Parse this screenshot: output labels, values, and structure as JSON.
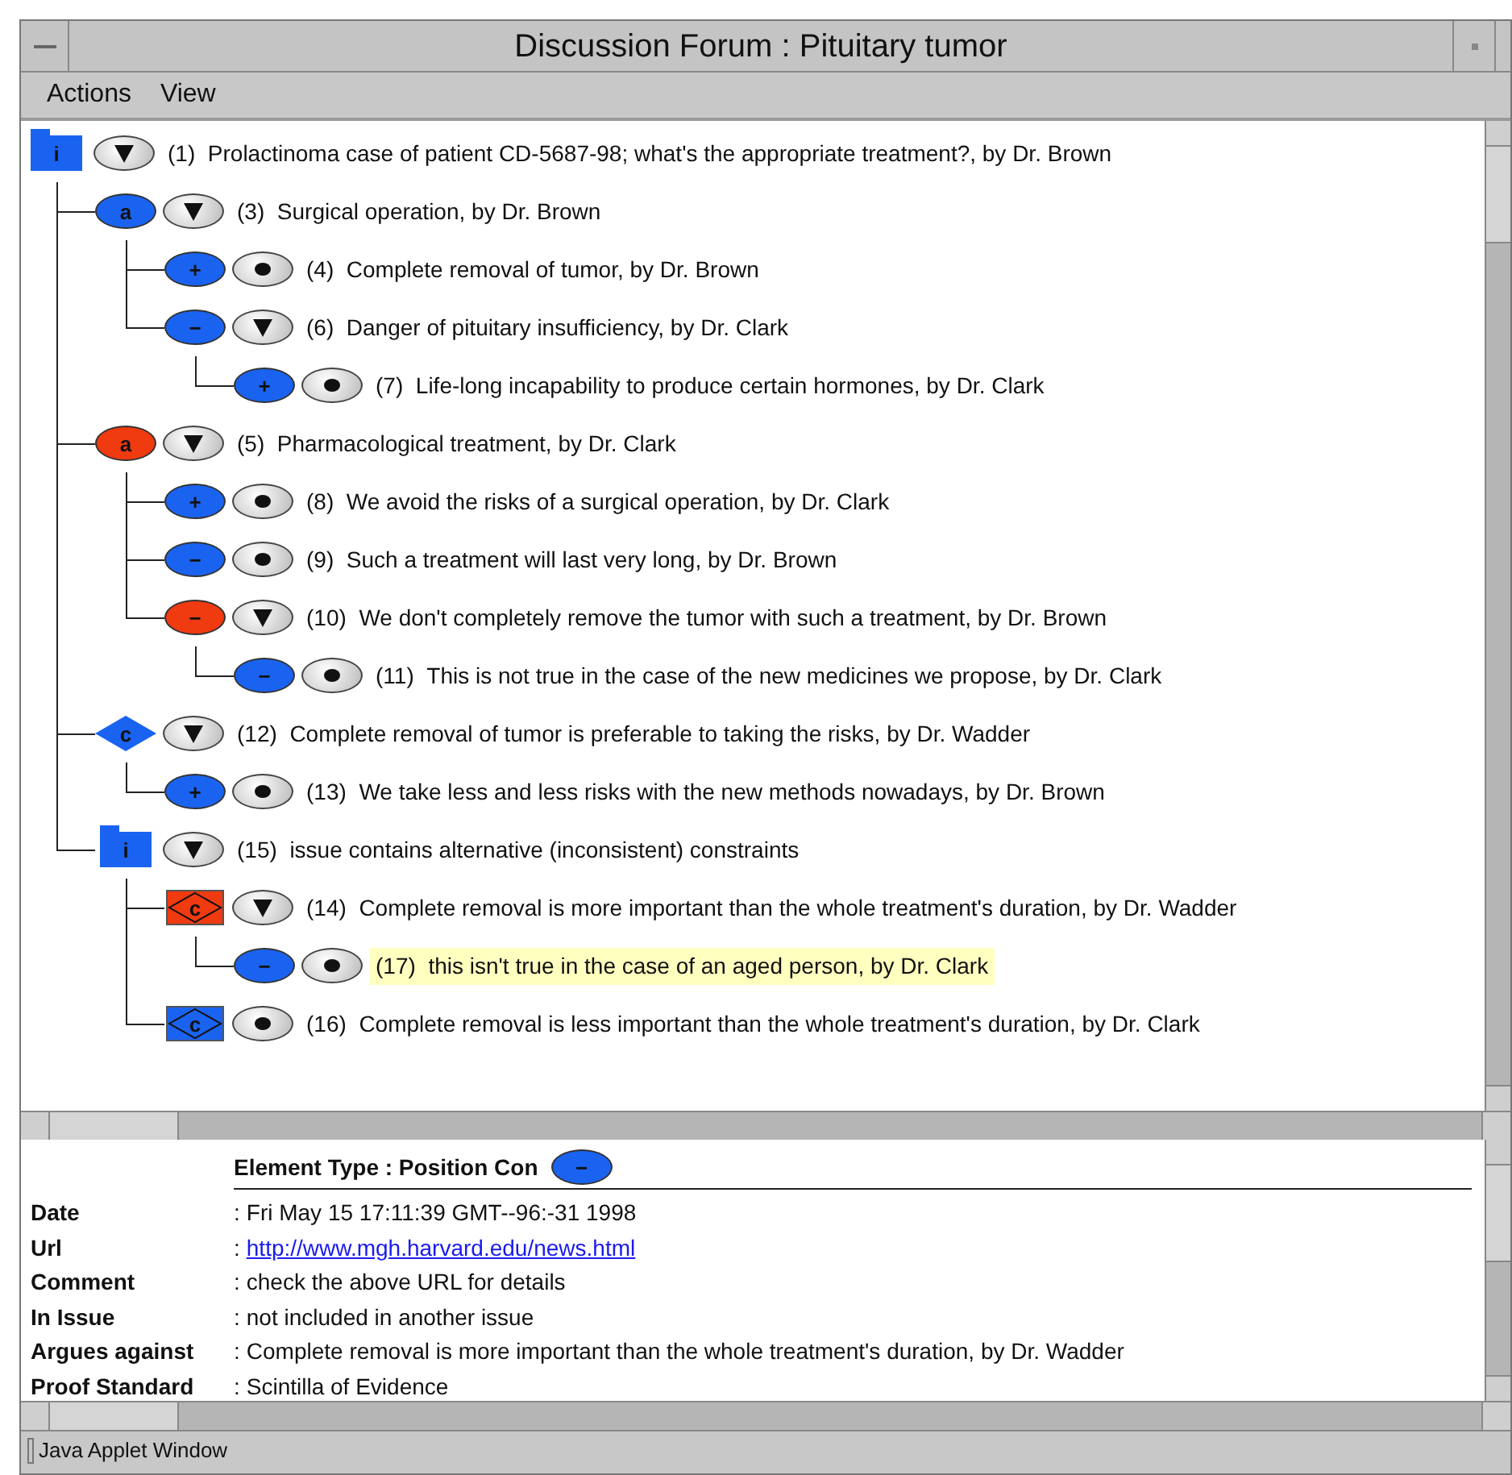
{
  "window": {
    "title": "Discussion Forum : Pituitary tumor"
  },
  "menu": [
    {
      "label": "Actions"
    },
    {
      "label": "View"
    }
  ],
  "tree": [
    {
      "kind": "folder",
      "symbol": "i",
      "color": "#1a63f0",
      "expandable": true,
      "number": "(1)",
      "text": "Prolactinoma case of patient CD-5687-98; what's the appropriate treatment?, by Dr. Brown",
      "highlighted": false,
      "children": [
        {
          "kind": "ellipse",
          "symbol": "a",
          "color": "#1a63f0",
          "expandable": true,
          "number": "(3)",
          "text": "Surgical operation, by Dr. Brown",
          "highlighted": false,
          "children": [
            {
              "kind": "ellipse",
              "symbol": "+",
              "color": "#1a63f0",
              "expandable": false,
              "number": "(4)",
              "text": "Complete removal of tumor, by Dr. Brown",
              "highlighted": false
            },
            {
              "kind": "ellipse",
              "symbol": "−",
              "color": "#1a63f0",
              "expandable": true,
              "number": "(6)",
              "text": "Danger of pituitary insufficiency, by Dr. Clark",
              "highlighted": false,
              "children": [
                {
                  "kind": "ellipse",
                  "symbol": "+",
                  "color": "#1a63f0",
                  "expandable": false,
                  "number": "(7)",
                  "text": "Life-long incapability to produce certain hormones, by Dr. Clark",
                  "highlighted": false
                }
              ]
            }
          ]
        },
        {
          "kind": "ellipse",
          "symbol": "a",
          "color": "#f03a10",
          "expandable": true,
          "number": "(5)",
          "text": "Pharmacological treatment, by Dr. Clark",
          "highlighted": false,
          "children": [
            {
              "kind": "ellipse",
              "symbol": "+",
              "color": "#1a63f0",
              "expandable": false,
              "number": "(8)",
              "text": "We avoid the risks of a surgical operation, by Dr. Clark",
              "highlighted": false
            },
            {
              "kind": "ellipse",
              "symbol": "−",
              "color": "#1a63f0",
              "expandable": false,
              "number": "(9)",
              "text": "Such a treatment will last very long, by Dr. Brown",
              "highlighted": false
            },
            {
              "kind": "ellipse",
              "symbol": "−",
              "color": "#f03a10",
              "expandable": true,
              "number": "(10)",
              "text": "We don't completely remove the tumor with such a treatment, by Dr. Brown",
              "highlighted": false,
              "children": [
                {
                  "kind": "ellipse",
                  "symbol": "−",
                  "color": "#1a63f0",
                  "expandable": false,
                  "number": "(11)",
                  "text": "This is not true in the case of the new medicines we propose, by Dr. Clark",
                  "highlighted": false
                }
              ]
            }
          ]
        },
        {
          "kind": "diamond",
          "symbol": "c",
          "color": "#1a63f0",
          "expandable": true,
          "number": "(12)",
          "text": "Complete removal of tumor is preferable to taking the risks, by Dr. Wadder",
          "highlighted": false,
          "children": [
            {
              "kind": "ellipse",
              "symbol": "+",
              "color": "#1a63f0",
              "expandable": false,
              "number": "(13)",
              "text": "We take less and less risks with the new methods nowadays, by Dr. Brown",
              "highlighted": false
            }
          ]
        },
        {
          "kind": "folder",
          "symbol": "i",
          "color": "#1a63f0",
          "expandable": true,
          "number": "(15)",
          "text": "issue contains alternative (inconsistent) constraints",
          "highlighted": false,
          "children": [
            {
              "kind": "boxed_diamond",
              "symbol": "c",
              "color": "#f03a10",
              "expandable": true,
              "number": "(14)",
              "text": "Complete removal is more important than the whole treatment's duration, by Dr. Wadder",
              "highlighted": false,
              "children": [
                {
                  "kind": "ellipse",
                  "symbol": "−",
                  "color": "#1a63f0",
                  "expandable": false,
                  "number": "(17)",
                  "text": "this isn't true in the case of an aged person, by Dr. Clark",
                  "highlighted": true
                }
              ]
            },
            {
              "kind": "boxed_diamond",
              "symbol": "c",
              "color": "#1a63f0",
              "expandable": false,
              "number": "(16)",
              "text": "Complete removal is less important than the whole treatment's duration, by Dr. Clark",
              "highlighted": false
            }
          ]
        }
      ]
    }
  ],
  "details": {
    "element_type": "Element Type : Position Con",
    "element_symbol": "−",
    "fields": [
      {
        "label": "Date",
        "separator": ":",
        "value": "Fri May 15 17:11:39 GMT--96:-31 1998",
        "kind": "text"
      },
      {
        "label": "Url",
        "separator": ":",
        "value": "http://www.mgh.harvard.edu/news.html",
        "kind": "link"
      },
      {
        "label": "Comment",
        "separator": ":",
        "value": "check the above URL for details",
        "kind": "text"
      },
      {
        "label": "In Issue",
        "separator": ":",
        "value": "not included in another issue",
        "kind": "text"
      },
      {
        "label": "Argues against",
        "separator": ":",
        "value": "Complete removal is more important than the whole treatment's duration, by Dr. Wadder",
        "kind": "text"
      },
      {
        "label": "Proof Standard",
        "separator": ":",
        "value": "Scintilla of Evidence",
        "kind": "text"
      }
    ]
  },
  "status_bar": {
    "text": "Java Applet Window"
  }
}
